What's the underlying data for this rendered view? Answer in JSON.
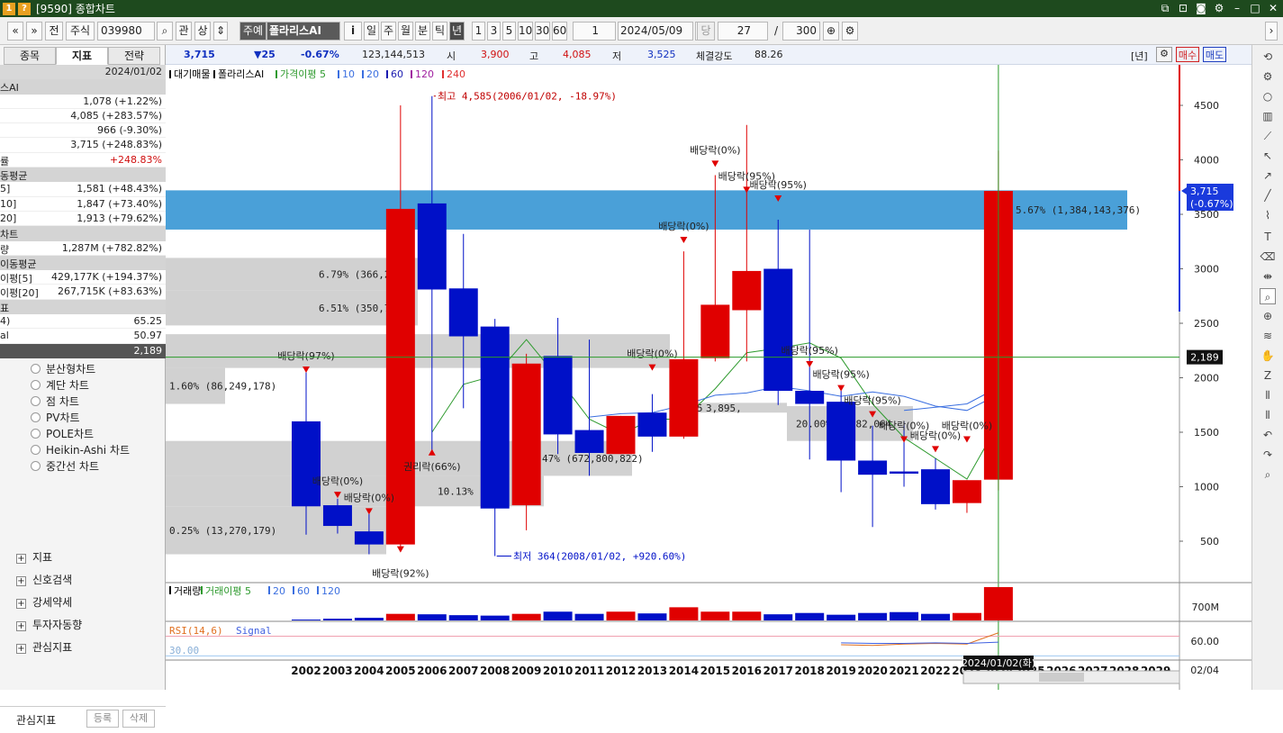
{
  "window": {
    "title": "[9590] 종합차트",
    "badge1": "1",
    "badge2": "?"
  },
  "toolbar": {
    "nav_prev": "«",
    "nav_down": "»",
    "before_label": "전",
    "market_label": "주식",
    "code": "039980",
    "search_icon": "⌕",
    "kwan_label": "관",
    "sang_label": "상",
    "preview_label": "주예",
    "stock_name": "폴라리스AI",
    "info_label": "i",
    "periods": [
      "일",
      "주",
      "월",
      "분",
      "틱",
      "년"
    ],
    "active_period": "년",
    "intervals": [
      "1",
      "3",
      "5",
      "10",
      "30",
      "60"
    ],
    "unit_value": "1",
    "date_value": "2024/05/09",
    "dang_label": "당",
    "count_value": "27",
    "slash": "/",
    "total_value": "300"
  },
  "quote": {
    "price": "3,715",
    "change": "▼25",
    "change_pct": "-0.67%",
    "volume": "123,144,513",
    "open_label": "시",
    "open": "3,900",
    "high_label": "고",
    "high": "4,085",
    "low_label": "저",
    "low": "3,525",
    "strength_label": "체결강도",
    "strength": "88.26",
    "period_tag": "[년]",
    "buy_label": "매수",
    "sell_label": "매도"
  },
  "left_panel": {
    "tabs": [
      "종목",
      "지표",
      "전략"
    ],
    "active_tab": "지표",
    "date": "2024/01/02",
    "rows": [
      {
        "label": "스AI",
        "value": "",
        "kind": "sect"
      },
      {
        "label": "",
        "value": "1,078 (+1.22%)",
        "kind": "val"
      },
      {
        "label": "",
        "value": "4,085 (+283.57%)",
        "kind": "val"
      },
      {
        "label": "",
        "value": "966 (-9.30%)",
        "kind": "val"
      },
      {
        "label": "",
        "value": "3,715 (+248.83%)",
        "kind": "val"
      },
      {
        "label": "률",
        "value": "+248.83%",
        "kind": "val",
        "red": true
      },
      {
        "label": "동평균",
        "value": "",
        "kind": "sect"
      },
      {
        "label": "5]",
        "value": "1,581 (+48.43%)",
        "kind": "val"
      },
      {
        "label": "10]",
        "value": "1,847 (+73.40%)",
        "kind": "val"
      },
      {
        "label": "20]",
        "value": "1,913 (+79.62%)",
        "kind": "val"
      },
      {
        "label": "차트",
        "value": "",
        "kind": "sect"
      },
      {
        "label": "량",
        "value": "1,287M (+782.82%)",
        "kind": "val"
      },
      {
        "label": "이동평균",
        "value": "",
        "kind": "sect"
      },
      {
        "label": "이평[5]",
        "value": "429,177K (+194.37%)",
        "kind": "val"
      },
      {
        "label": "이평[20]",
        "value": "267,715K (+83.63%)",
        "kind": "val"
      },
      {
        "label": "표",
        "value": "",
        "kind": "sect"
      },
      {
        "label": "4)",
        "value": "65.25",
        "kind": "val"
      },
      {
        "label": "al",
        "value": "50.97",
        "kind": "val"
      },
      {
        "label": "",
        "value": "2,189",
        "kind": "foot"
      }
    ],
    "chart_types": [
      "분산형차트",
      "계단 차트",
      "점 차트",
      "PV차트",
      "POLE차트",
      "Heikin-Ashi 차트",
      "중간선 차트"
    ],
    "tree": [
      "지표",
      "신호검색",
      "강세약세",
      "투자자동향",
      "관심지표"
    ],
    "bottom_label": "관심지표",
    "register_label": "등록",
    "delete_label": "삭제"
  },
  "chart_data": {
    "type": "candlestick",
    "title": "",
    "x_unit": "year",
    "ylim": [
      250,
      4800
    ],
    "y_ticks": [
      500,
      1000,
      1500,
      2000,
      2500,
      3000,
      3500,
      4000,
      4500
    ],
    "candles": [
      {
        "year": 2002,
        "open": 1600,
        "close": 820,
        "high": 2050,
        "low": 560
      },
      {
        "year": 2003,
        "open": 830,
        "close": 640,
        "high": 890,
        "low": 570
      },
      {
        "year": 2004,
        "open": 590,
        "close": 470,
        "high": 750,
        "low": 380
      },
      {
        "year": 2005,
        "open": 470,
        "close": 3550,
        "high": 4500,
        "low": 450
      },
      {
        "year": 2006,
        "open": 3600,
        "close": 2810,
        "high": 4585,
        "low": 1320
      },
      {
        "year": 2007,
        "open": 2820,
        "close": 2380,
        "high": 3320,
        "low": 1720
      },
      {
        "year": 2008,
        "open": 2470,
        "close": 800,
        "high": 2540,
        "low": 364
      },
      {
        "year": 2009,
        "open": 830,
        "close": 2130,
        "high": 2220,
        "low": 600
      },
      {
        "year": 2010,
        "open": 2200,
        "close": 1480,
        "high": 2550,
        "low": 1300
      },
      {
        "year": 2011,
        "open": 1520,
        "close": 1310,
        "high": 2350,
        "low": 1100
      },
      {
        "year": 2012,
        "open": 1300,
        "close": 1650,
        "high": 1650,
        "low": 1300
      },
      {
        "year": 2013,
        "open": 1680,
        "close": 1460,
        "high": 1850,
        "low": 1320
      },
      {
        "year": 2014,
        "open": 1460,
        "close": 2170,
        "high": 3160,
        "low": 1440
      },
      {
        "year": 2015,
        "open": 2180,
        "close": 2670,
        "high": 3860,
        "low": 2150
      },
      {
        "year": 2016,
        "open": 2620,
        "close": 2980,
        "high": 4320,
        "low": 2150
      },
      {
        "year": 2017,
        "open": 3000,
        "close": 1880,
        "high": 3450,
        "low": 1750
      },
      {
        "year": 2018,
        "open": 1880,
        "close": 1760,
        "high": 3360,
        "low": 1250
      },
      {
        "year": 2019,
        "open": 1780,
        "close": 1240,
        "high": 1880,
        "low": 950
      },
      {
        "year": 2020,
        "open": 1240,
        "close": 1110,
        "high": 1560,
        "low": 630
      },
      {
        "year": 2021,
        "open": 1140,
        "close": 1120,
        "high": 1600,
        "low": 1000
      },
      {
        "year": 2022,
        "open": 1160,
        "close": 840,
        "high": 1260,
        "low": 790
      },
      {
        "year": 2023,
        "open": 850,
        "close": 1060,
        "high": 1060,
        "low": 760
      },
      {
        "year": 2024,
        "open": 1065,
        "close": 3715,
        "high": 4085,
        "low": 966
      }
    ],
    "x_labels": [
      "2002",
      "2003",
      "2004",
      "2005",
      "2006",
      "2007",
      "2008",
      "2009",
      "2010",
      "2011",
      "2012",
      "2013",
      "2014",
      "2015",
      "2016",
      "2017",
      "2018",
      "2019",
      "2020",
      "2021",
      "2022",
      "2023",
      "2024",
      "2025",
      "2026",
      "2027",
      "2028",
      "2029"
    ],
    "legend": [
      "대기매물",
      "폴라리스AI",
      "가격이평 5",
      "10",
      "20",
      "60",
      "120",
      "240"
    ],
    "legend_colors": [
      "#000000",
      "#000000",
      "#2e9a2e",
      "#3b6fe0",
      "#3b6fe0",
      "#1a1ab0",
      "#a020a0",
      "#e03030"
    ],
    "ma5": [
      [
        2006,
        1500
      ],
      [
        2007,
        1940
      ],
      [
        2008,
        2020
      ],
      [
        2009,
        2350
      ],
      [
        2010,
        2000
      ],
      [
        2011,
        1620
      ],
      [
        2012,
        1480
      ],
      [
        2013,
        1620
      ],
      [
        2014,
        1620
      ],
      [
        2015,
        1900
      ],
      [
        2016,
        2230
      ],
      [
        2017,
        2270
      ],
      [
        2018,
        2320
      ],
      [
        2019,
        2180
      ],
      [
        2020,
        1760
      ],
      [
        2021,
        1450
      ],
      [
        2022,
        1260
      ],
      [
        2023,
        1070
      ],
      [
        2024,
        1581
      ]
    ],
    "ma10": [
      [
        2011,
        1640
      ],
      [
        2012,
        1670
      ],
      [
        2013,
        1680
      ],
      [
        2014,
        1750
      ],
      [
        2015,
        1840
      ],
      [
        2016,
        1860
      ],
      [
        2017,
        1920
      ],
      [
        2018,
        1880
      ],
      [
        2019,
        1830
      ],
      [
        2020,
        1870
      ],
      [
        2021,
        1830
      ],
      [
        2022,
        1740
      ],
      [
        2023,
        1700
      ],
      [
        2024,
        1847
      ]
    ],
    "ma20": [
      [
        2021,
        1700
      ],
      [
        2022,
        1730
      ],
      [
        2023,
        1760
      ],
      [
        2024,
        1913
      ]
    ],
    "supply_zones": [
      {
        "low": 3360,
        "high": 3720,
        "label": "5.67% (1,384,143,376)",
        "highlight": true
      },
      {
        "low": 2800,
        "high": 3100,
        "label": "6.79% (366,21"
      },
      {
        "low": 2480,
        "high": 2800,
        "label": "6.51% (350,799,"
      },
      {
        "low": 2090,
        "high": 2400,
        "label": ""
      },
      {
        "low": 1760,
        "high": 2090,
        "label": "1.60% (86,249,178)"
      },
      {
        "low": 1680,
        "high": 1770,
        "label": "15.5",
        "label_b": "3,895,"
      },
      {
        "low": 1420,
        "high": 1740,
        "label": "20.00%",
        "label_b": "78,282,064"
      },
      {
        "low": 1100,
        "high": 1420,
        "label": "47% (672,800,822)"
      },
      {
        "low": 820,
        "high": 1100,
        "label": "10.13% (5"
      },
      {
        "low": 380,
        "high": 820,
        "label": "0.25% (13,270,179)"
      }
    ],
    "dividends": [
      {
        "year": 2002,
        "y": 2070,
        "label": "배당락(97%)"
      },
      {
        "year": 2003,
        "y": 920,
        "label": "배당락(0%)"
      },
      {
        "year": 2004,
        "y": 770,
        "label": "배당락(0%)"
      },
      {
        "year": 2005,
        "y": 420,
        "label": "배당락(92%)",
        "below": true
      },
      {
        "year": 2006,
        "y": 1320,
        "label": "권리락(66%)",
        "up": true
      },
      {
        "year": 2013,
        "y": 2090,
        "label": "배당락(0%)"
      },
      {
        "year": 2014,
        "y": 3260,
        "label": "배당락(0%)"
      },
      {
        "year": 2015,
        "y": 3960,
        "label": "배당락(0%)"
      },
      {
        "year": 2016,
        "y": 3720,
        "label": "배당락(95%)"
      },
      {
        "year": 2017,
        "y": 3640,
        "label": "배당락(95%)"
      },
      {
        "year": 2018,
        "y": 2120,
        "label": "배당락(95%)"
      },
      {
        "year": 2019,
        "y": 1900,
        "label": "배당락(95%)"
      },
      {
        "year": 2020,
        "y": 1660,
        "label": "배당락(95%)"
      },
      {
        "year": 2021,
        "y": 1430,
        "label": "배당락(0%)"
      },
      {
        "year": 2022,
        "y": 1340,
        "label": "배당락(0%)"
      },
      {
        "year": 2023,
        "y": 1430,
        "label": "배당락(0%)"
      }
    ],
    "max_label": "최고 4,585(2006/01/02, -18.97%)",
    "min_label": "최저 364(2008/01/02, +920.60%)",
    "current_price": 3715,
    "current_label": "3,715",
    "current_change": "(-0.67%)",
    "crosshair_value": 2189,
    "crosshair_label": "2,189",
    "crosshair_date": "2024/01/02(화)",
    "volume_panel": {
      "legend": [
        "거래량",
        "거래이평 5",
        "20",
        "60",
        "120"
      ],
      "max_label": "700M",
      "values": [
        20,
        40,
        60,
        150,
        140,
        120,
        110,
        150,
        200,
        150,
        200,
        160,
        300,
        200,
        200,
        140,
        170,
        130,
        170,
        190,
        150,
        170,
        760
      ],
      "ylim": [
        0,
        800
      ]
    },
    "rsi_panel": {
      "legend": [
        "RSI(14,6)",
        "Signal"
      ],
      "tick_high": "60.00",
      "tick_low": "30.00",
      "rsi": [
        [
          2019,
          47
        ],
        [
          2020,
          46
        ],
        [
          2021,
          48
        ],
        [
          2022,
          49
        ],
        [
          2023,
          48
        ],
        [
          2024,
          65.25
        ]
      ],
      "signal": [
        [
          2019,
          50
        ],
        [
          2020,
          49
        ],
        [
          2021,
          49
        ],
        [
          2022,
          50
        ],
        [
          2023,
          49
        ],
        [
          2024,
          50.97
        ]
      ],
      "ylim": [
        25,
        80
      ]
    },
    "y_axis_marker": "02/04"
  }
}
